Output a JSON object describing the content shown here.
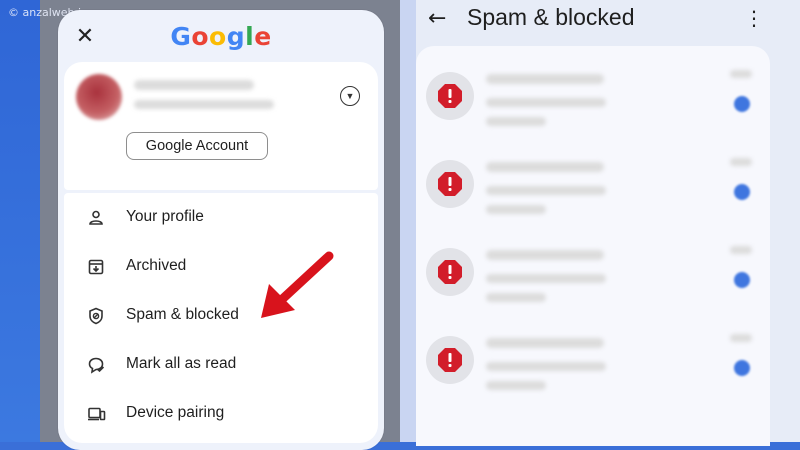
{
  "watermark": "© anzalweb.ir",
  "drawer": {
    "close_label": "✕",
    "brand": {
      "letters": [
        "G",
        "o",
        "o",
        "g",
        "l",
        "e"
      ],
      "colors": [
        "#4285F4",
        "#EA4335",
        "#FBBC05",
        "#4285F4",
        "#34A853",
        "#EA4335"
      ]
    },
    "account_button": "Google Account",
    "account_toggle_icon": "chevron-down-icon",
    "menu": [
      {
        "label": "Your profile",
        "icon": "person-icon"
      },
      {
        "label": "Archived",
        "icon": "archive-icon"
      },
      {
        "label": "Spam & blocked",
        "icon": "shield-icon"
      },
      {
        "label": "Mark all as read",
        "icon": "chat-check-icon"
      },
      {
        "label": "Device pairing",
        "icon": "devices-icon"
      }
    ]
  },
  "annotation": {
    "color": "#d8131c",
    "points_to": "Spam & blocked"
  },
  "spam_screen": {
    "title": "Spam & blocked",
    "back_icon": "arrow-back-icon",
    "more_icon": "more-vert-icon",
    "badge_color": "#d21d2a",
    "unread_dot_color": "#3f76df",
    "conversations": [
      {
        "icon": "spam-warning-icon",
        "unread": true
      },
      {
        "icon": "spam-warning-icon",
        "unread": true
      },
      {
        "icon": "spam-warning-icon",
        "unread": true
      },
      {
        "icon": "spam-warning-icon",
        "unread": true
      }
    ]
  }
}
